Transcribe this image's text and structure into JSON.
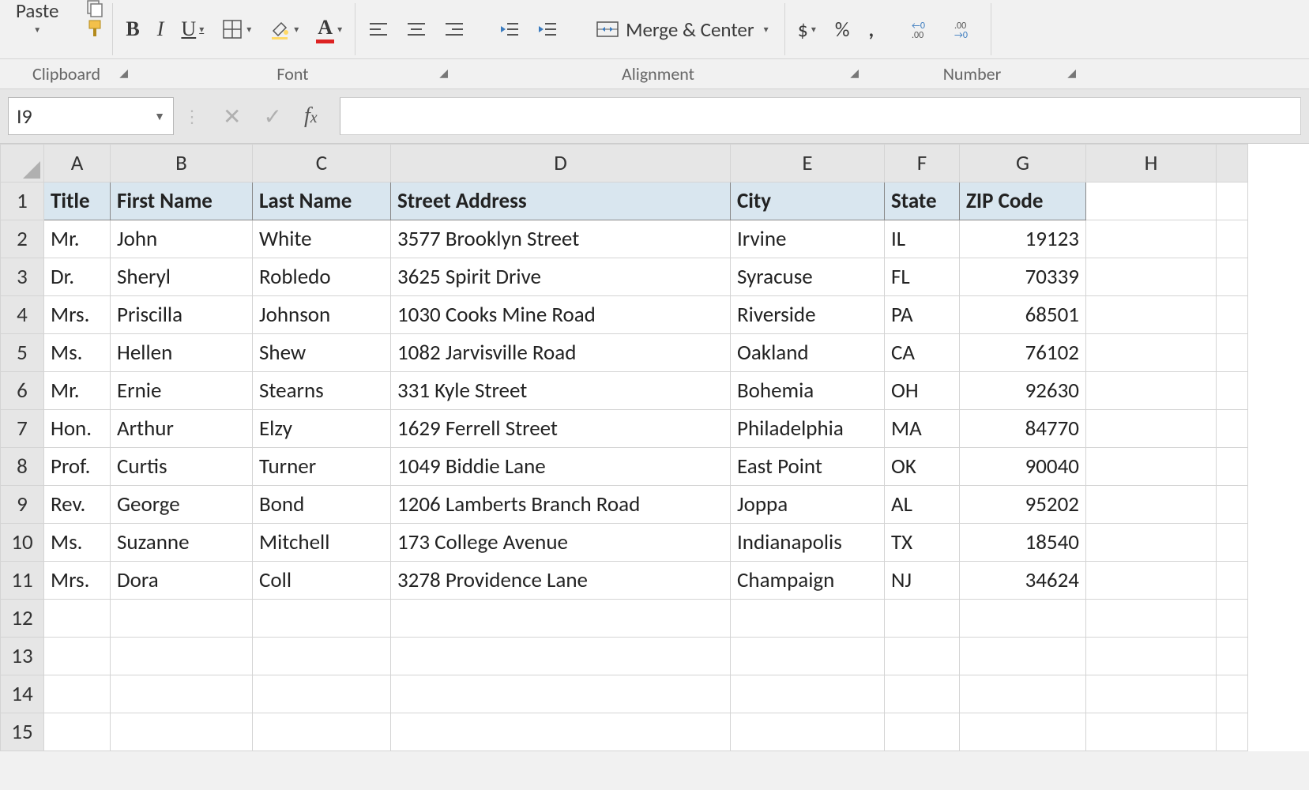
{
  "ribbon": {
    "paste": "Paste",
    "groups": {
      "clipboard": "Clipboard",
      "font": "Font",
      "alignment": "Alignment",
      "number": "Number"
    },
    "merge": "Merge & Center",
    "currency": "$",
    "percent": "%",
    "comma": ","
  },
  "formula_bar": {
    "name_box": "I9",
    "formula": ""
  },
  "columns": [
    "A",
    "B",
    "C",
    "D",
    "E",
    "F",
    "G",
    "H"
  ],
  "headers": [
    "Title",
    "First Name",
    "Last Name",
    "Street Address",
    "City",
    "State",
    "ZIP Code"
  ],
  "rows": [
    {
      "n": "2",
      "title": "Mr.",
      "first": "John",
      "last": "White",
      "street": "3577 Brooklyn Street",
      "city": "Irvine",
      "state": "IL",
      "zip": "19123"
    },
    {
      "n": "3",
      "title": "Dr.",
      "first": "Sheryl",
      "last": "Robledo",
      "street": "3625 Spirit Drive",
      "city": "Syracuse",
      "state": "FL",
      "zip": "70339"
    },
    {
      "n": "4",
      "title": "Mrs.",
      "first": "Priscilla",
      "last": "Johnson",
      "street": "1030 Cooks Mine Road",
      "city": "Riverside",
      "state": "PA",
      "zip": "68501"
    },
    {
      "n": "5",
      "title": "Ms.",
      "first": "Hellen",
      "last": "Shew",
      "street": "1082 Jarvisville Road",
      "city": "Oakland",
      "state": "CA",
      "zip": "76102"
    },
    {
      "n": "6",
      "title": "Mr.",
      "first": "Ernie",
      "last": "Stearns",
      "street": "331 Kyle Street",
      "city": "Bohemia",
      "state": "OH",
      "zip": "92630"
    },
    {
      "n": "7",
      "title": "Hon.",
      "first": "Arthur",
      "last": "Elzy",
      "street": "1629 Ferrell Street",
      "city": "Philadelphia",
      "state": "MA",
      "zip": "84770"
    },
    {
      "n": "8",
      "title": "Prof.",
      "first": "Curtis",
      "last": "Turner",
      "street": "1049 Biddie Lane",
      "city": "East Point",
      "state": "OK",
      "zip": "90040"
    },
    {
      "n": "9",
      "title": "Rev.",
      "first": "George",
      "last": "Bond",
      "street": "1206 Lamberts Branch Road",
      "city": "Joppa",
      "state": "AL",
      "zip": "95202"
    },
    {
      "n": "10",
      "title": "Ms.",
      "first": "Suzanne",
      "last": "Mitchell",
      "street": "173 College Avenue",
      "city": "Indianapolis",
      "state": "TX",
      "zip": "18540"
    },
    {
      "n": "11",
      "title": "Mrs.",
      "first": "Dora",
      "last": "Coll",
      "street": "3278 Providence Lane",
      "city": "Champaign",
      "state": "NJ",
      "zip": "34624"
    }
  ],
  "empty_rows": [
    "12",
    "13",
    "14",
    "15"
  ]
}
